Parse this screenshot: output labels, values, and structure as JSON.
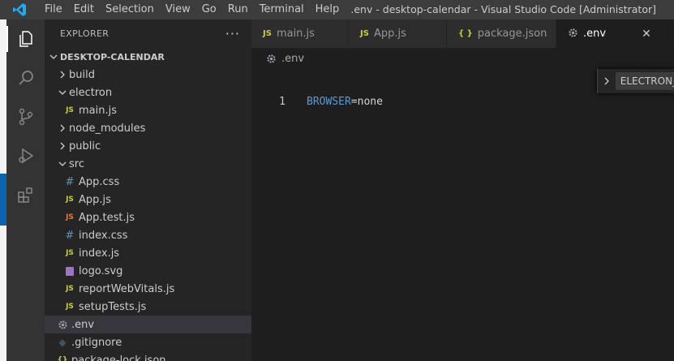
{
  "titlebar": {
    "menu": [
      "File",
      "Edit",
      "Selection",
      "View",
      "Go",
      "Run",
      "Terminal",
      "Help"
    ],
    "window_title": ".env - desktop-calendar - Visual Studio Code [Administrator]"
  },
  "activitybar": {
    "icons": [
      "explorer-icon",
      "search-icon",
      "source-control-icon",
      "run-debug-icon",
      "extensions-icon"
    ]
  },
  "sidebar": {
    "title": "EXPLORER",
    "more": "···",
    "root": "DESKTOP-CALENDAR",
    "items": [
      {
        "label": "build"
      },
      {
        "label": "electron"
      },
      {
        "label": "main.js"
      },
      {
        "label": "node_modules"
      },
      {
        "label": "public"
      },
      {
        "label": "src"
      },
      {
        "label": "App.css"
      },
      {
        "label": "App.js"
      },
      {
        "label": "App.test.js"
      },
      {
        "label": "index.css"
      },
      {
        "label": "index.js"
      },
      {
        "label": "logo.svg"
      },
      {
        "label": "reportWebVitals.js"
      },
      {
        "label": "setupTests.js"
      },
      {
        "label": ".env"
      },
      {
        "label": ".gitignore"
      },
      {
        "label": "package-lock.json"
      }
    ]
  },
  "tabs": [
    {
      "label": "main.js",
      "icon": "JS"
    },
    {
      "label": "App.js",
      "icon": "JS"
    },
    {
      "label": "package.json",
      "icon": "{ }"
    },
    {
      "label": ".env",
      "icon": "gear-icon"
    }
  ],
  "breadcrumb": ".env",
  "editor": {
    "line_number": "1",
    "key": "BROWSER",
    "op": "=",
    "value": "none"
  },
  "peek": {
    "label": "ELECTRON_START_URL"
  },
  "colors": {
    "js": "#cbcb41",
    "css": "#519aba",
    "test": "#e37933",
    "svg": "#a074c4",
    "keyword": "#569cd6"
  }
}
